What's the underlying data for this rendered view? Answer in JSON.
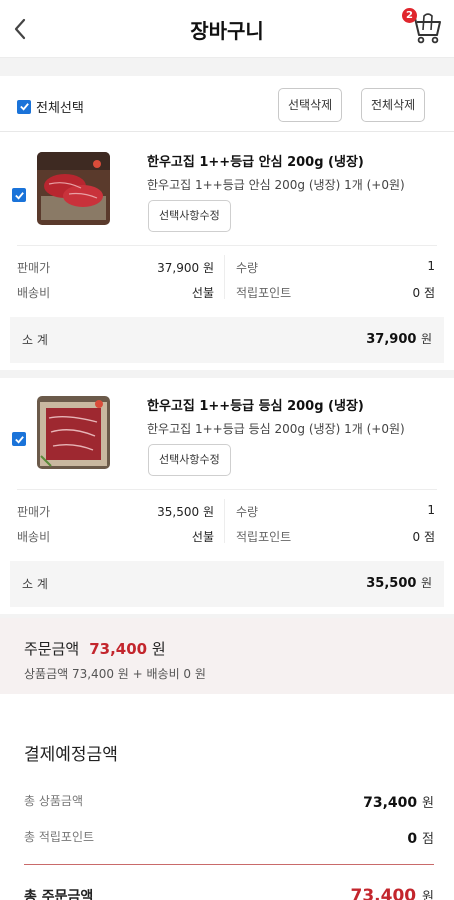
{
  "header": {
    "title": "장바구니",
    "cart_count": "2"
  },
  "toolbar": {
    "select_all_label": "전체선택",
    "delete_selected_label": "선택삭제",
    "delete_all_label": "전체삭제"
  },
  "items": [
    {
      "name": "한우고집 1++등급 안심 200g (냉장)",
      "option": "한우고집 1++등급 안심 200g (냉장) 1개 (+0원)",
      "edit_label": "선택사항수정",
      "price_label": "판매가",
      "price_value": "37,900 원",
      "qty_label": "수량",
      "qty_value": "1",
      "shipping_label": "배송비",
      "shipping_value": "선불",
      "points_label": "적립포인트",
      "points_value": "0 점",
      "subtotal_label": "소 계",
      "subtotal_value": "37,900",
      "subtotal_unit": "원"
    },
    {
      "name": "한우고집 1++등급 등심 200g (냉장)",
      "option": "한우고집 1++등급 등심 200g (냉장) 1개 (+0원)",
      "edit_label": "선택사항수정",
      "price_label": "판매가",
      "price_value": "35,500 원",
      "qty_label": "수량",
      "qty_value": "1",
      "shipping_label": "배송비",
      "shipping_value": "선불",
      "points_label": "적립포인트",
      "points_value": "0 점",
      "subtotal_label": "소 계",
      "subtotal_value": "35,500",
      "subtotal_unit": "원"
    }
  ],
  "order": {
    "label": "주문금액",
    "amount": "73,400",
    "unit": "원",
    "detail": "상품금액 73,400 원 + 배송비 0 원"
  },
  "payment": {
    "title": "결제예정금액",
    "product_label": "총 상품금액",
    "product_value": "73,400",
    "product_unit": "원",
    "points_label": "총 적립포인트",
    "points_value": "0",
    "points_unit": "점",
    "total_label": "총 주문금액",
    "total_value": "73,400",
    "total_unit": "원"
  },
  "colors": {
    "accent": "#c3262d",
    "checkbox": "#1a73d9",
    "badge": "#e0262d"
  }
}
